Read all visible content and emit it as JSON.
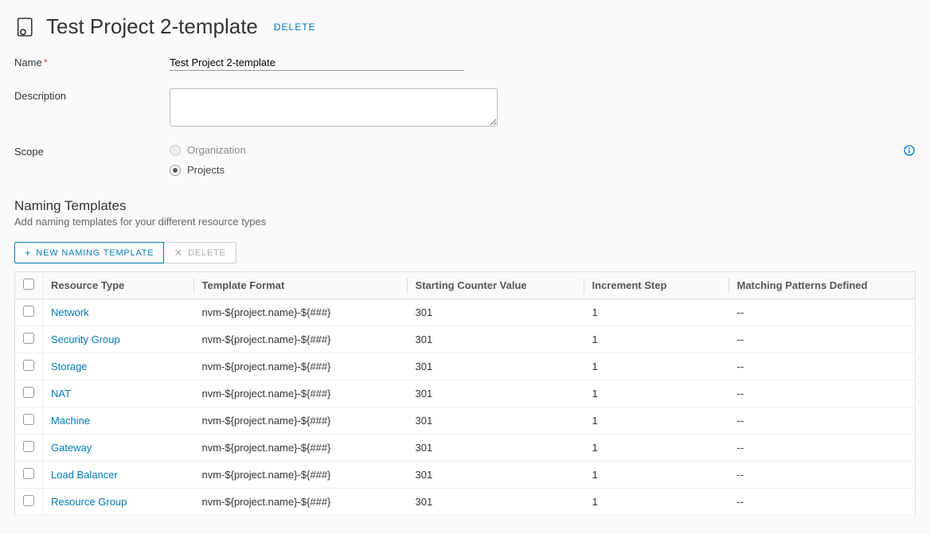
{
  "header": {
    "title": "Test Project 2-template",
    "delete_label": "DELETE"
  },
  "form": {
    "name_label": "Name",
    "name_value": "Test Project 2-template",
    "description_label": "Description",
    "description_value": "",
    "scope_label": "Scope",
    "scope_options": {
      "organization": "Organization",
      "projects": "Projects"
    }
  },
  "section": {
    "title": "Naming Templates",
    "subtitle": "Add naming templates for your different resource types"
  },
  "toolbar": {
    "new_label": "NEW NAMING TEMPLATE",
    "delete_label": "DELETE"
  },
  "table": {
    "columns": {
      "resource_type": "Resource Type",
      "template_format": "Template Format",
      "starting_counter": "Starting Counter Value",
      "increment_step": "Increment Step",
      "matching_patterns": "Matching Patterns Defined"
    },
    "rows": [
      {
        "type": "Network",
        "format": "nvm-${project.name}-${###}",
        "counter": "301",
        "step": "1",
        "patterns": "--"
      },
      {
        "type": "Security Group",
        "format": "nvm-${project.name}-${###}",
        "counter": "301",
        "step": "1",
        "patterns": "--"
      },
      {
        "type": "Storage",
        "format": "nvm-${project.name}-${###}",
        "counter": "301",
        "step": "1",
        "patterns": "--"
      },
      {
        "type": "NAT",
        "format": "nvm-${project.name}-${###}",
        "counter": "301",
        "step": "1",
        "patterns": "--"
      },
      {
        "type": "Machine",
        "format": "nvm-${project.name}-${###}",
        "counter": "301",
        "step": "1",
        "patterns": "--"
      },
      {
        "type": "Gateway",
        "format": "nvm-${project.name}-${###}",
        "counter": "301",
        "step": "1",
        "patterns": "--"
      },
      {
        "type": "Load Balancer",
        "format": "nvm-${project.name}-${###}",
        "counter": "301",
        "step": "1",
        "patterns": "--"
      },
      {
        "type": "Resource Group",
        "format": "nvm-${project.name}-${###}",
        "counter": "301",
        "step": "1",
        "patterns": "--"
      }
    ]
  }
}
